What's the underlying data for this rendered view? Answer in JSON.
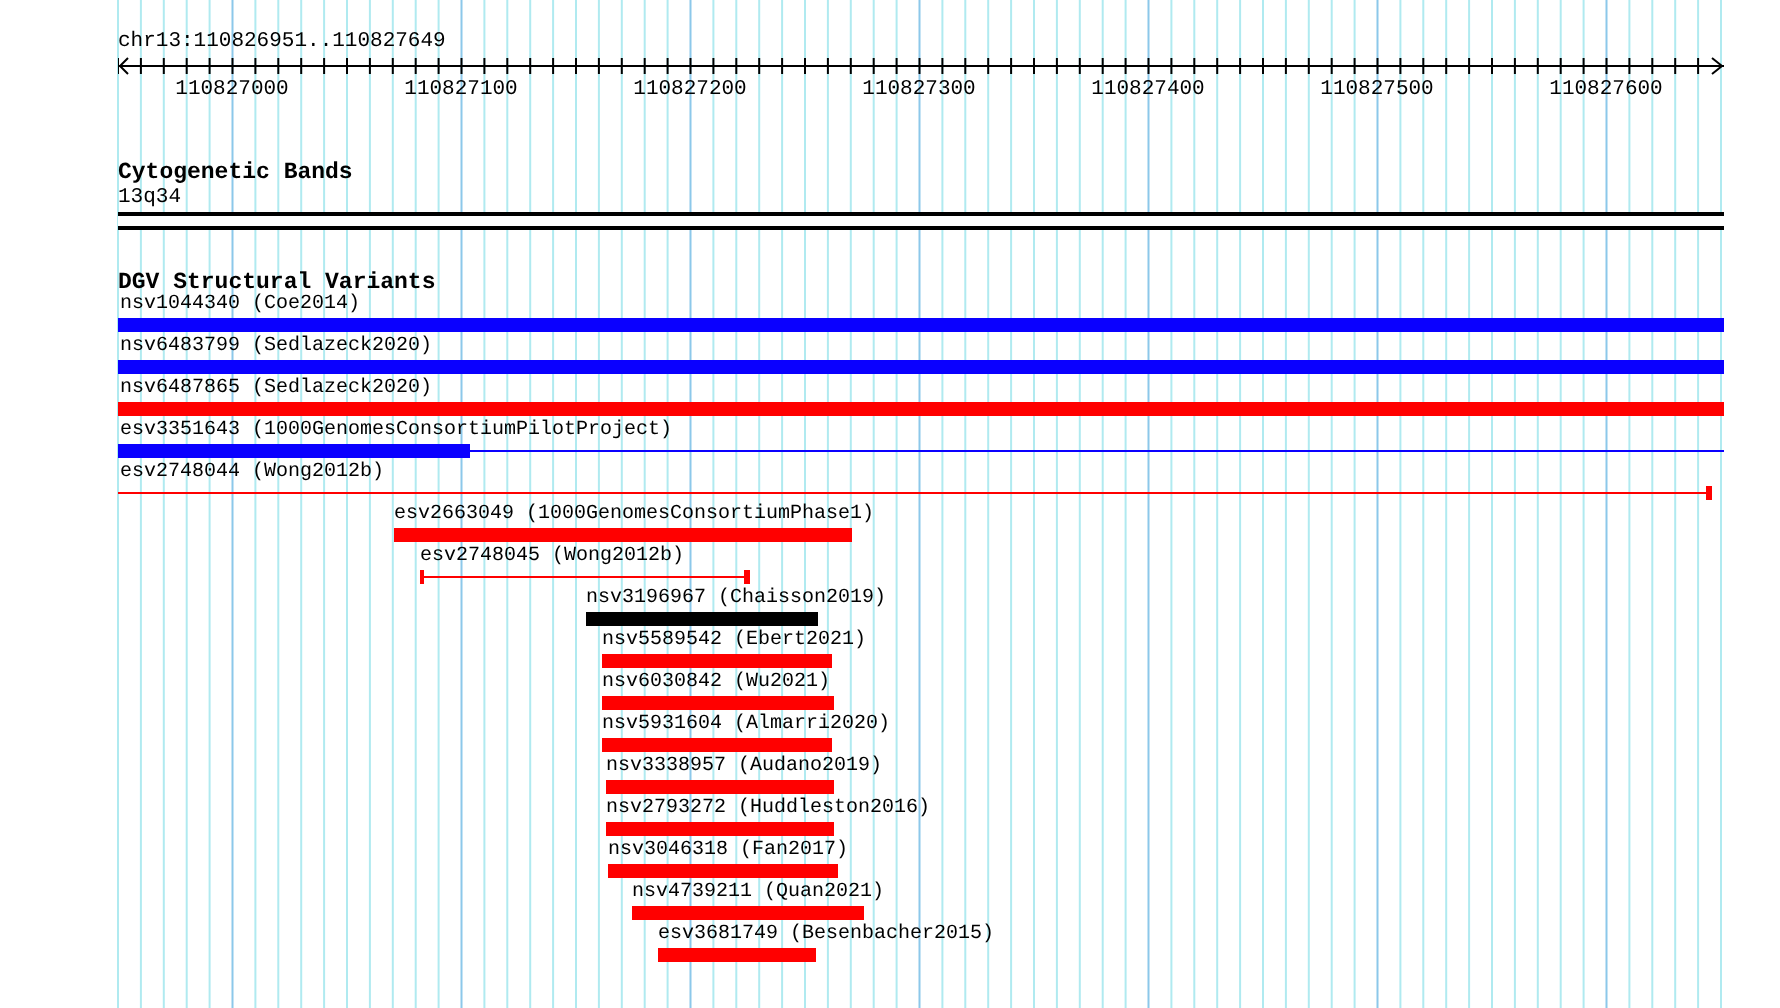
{
  "ruler": {
    "location": "chr13:110826951..110827649",
    "tick_labels": [
      "110827000",
      "110827100",
      "110827200",
      "110827300",
      "110827400",
      "110827500",
      "110827600"
    ]
  },
  "tracks": [
    {
      "title": "Cytogenetic Bands",
      "kind": "bands",
      "features": [
        {
          "label": "13q34"
        }
      ]
    },
    {
      "title": "DGV Structural Variants",
      "kind": "variants",
      "features": [
        {
          "label": "nsv1044340 (Coe2014)",
          "color": "#0a00ff",
          "kind": "bar"
        },
        {
          "label": "nsv6483799 (Sedlazeck2020)",
          "color": "#0a00ff",
          "kind": "bar"
        },
        {
          "label": "nsv6487865 (Sedlazeck2020)",
          "color": "#ff0000",
          "kind": "bar"
        },
        {
          "label": "esv3351643 (1000GenomesConsortiumPilotProject)",
          "color": "#0a00ff",
          "kind": "partial"
        },
        {
          "label": "esv2748044 (Wong2012b)",
          "color": "#ff0000",
          "kind": "line"
        },
        {
          "label": "esv2663049 (1000GenomesConsortiumPhase1)",
          "color": "#ff0000",
          "kind": "bar"
        },
        {
          "label": "esv2748045 (Wong2012b)",
          "color": "#ff0000",
          "kind": "line"
        },
        {
          "label": "nsv3196967 (Chaisson2019)",
          "color": "#000000",
          "kind": "bar"
        },
        {
          "label": "nsv5589542 (Ebert2021)",
          "color": "#ff0000",
          "kind": "bar"
        },
        {
          "label": "nsv6030842 (Wu2021)",
          "color": "#ff0000",
          "kind": "bar"
        },
        {
          "label": "nsv5931604 (Almarri2020)",
          "color": "#ff0000",
          "kind": "bar"
        },
        {
          "label": "nsv3338957 (Audano2019)",
          "color": "#ff0000",
          "kind": "bar"
        },
        {
          "label": "nsv2793272 (Huddleston2016)",
          "color": "#ff0000",
          "kind": "bar"
        },
        {
          "label": "nsv3046318 (Fan2017)",
          "color": "#ff0000",
          "kind": "bar"
        },
        {
          "label": "nsv4739211 (Quan2021)",
          "color": "#ff0000",
          "kind": "bar"
        },
        {
          "label": "esv3681749 (Besenbacher2015)",
          "color": "#ff0000",
          "kind": "bar"
        }
      ]
    }
  ]
}
